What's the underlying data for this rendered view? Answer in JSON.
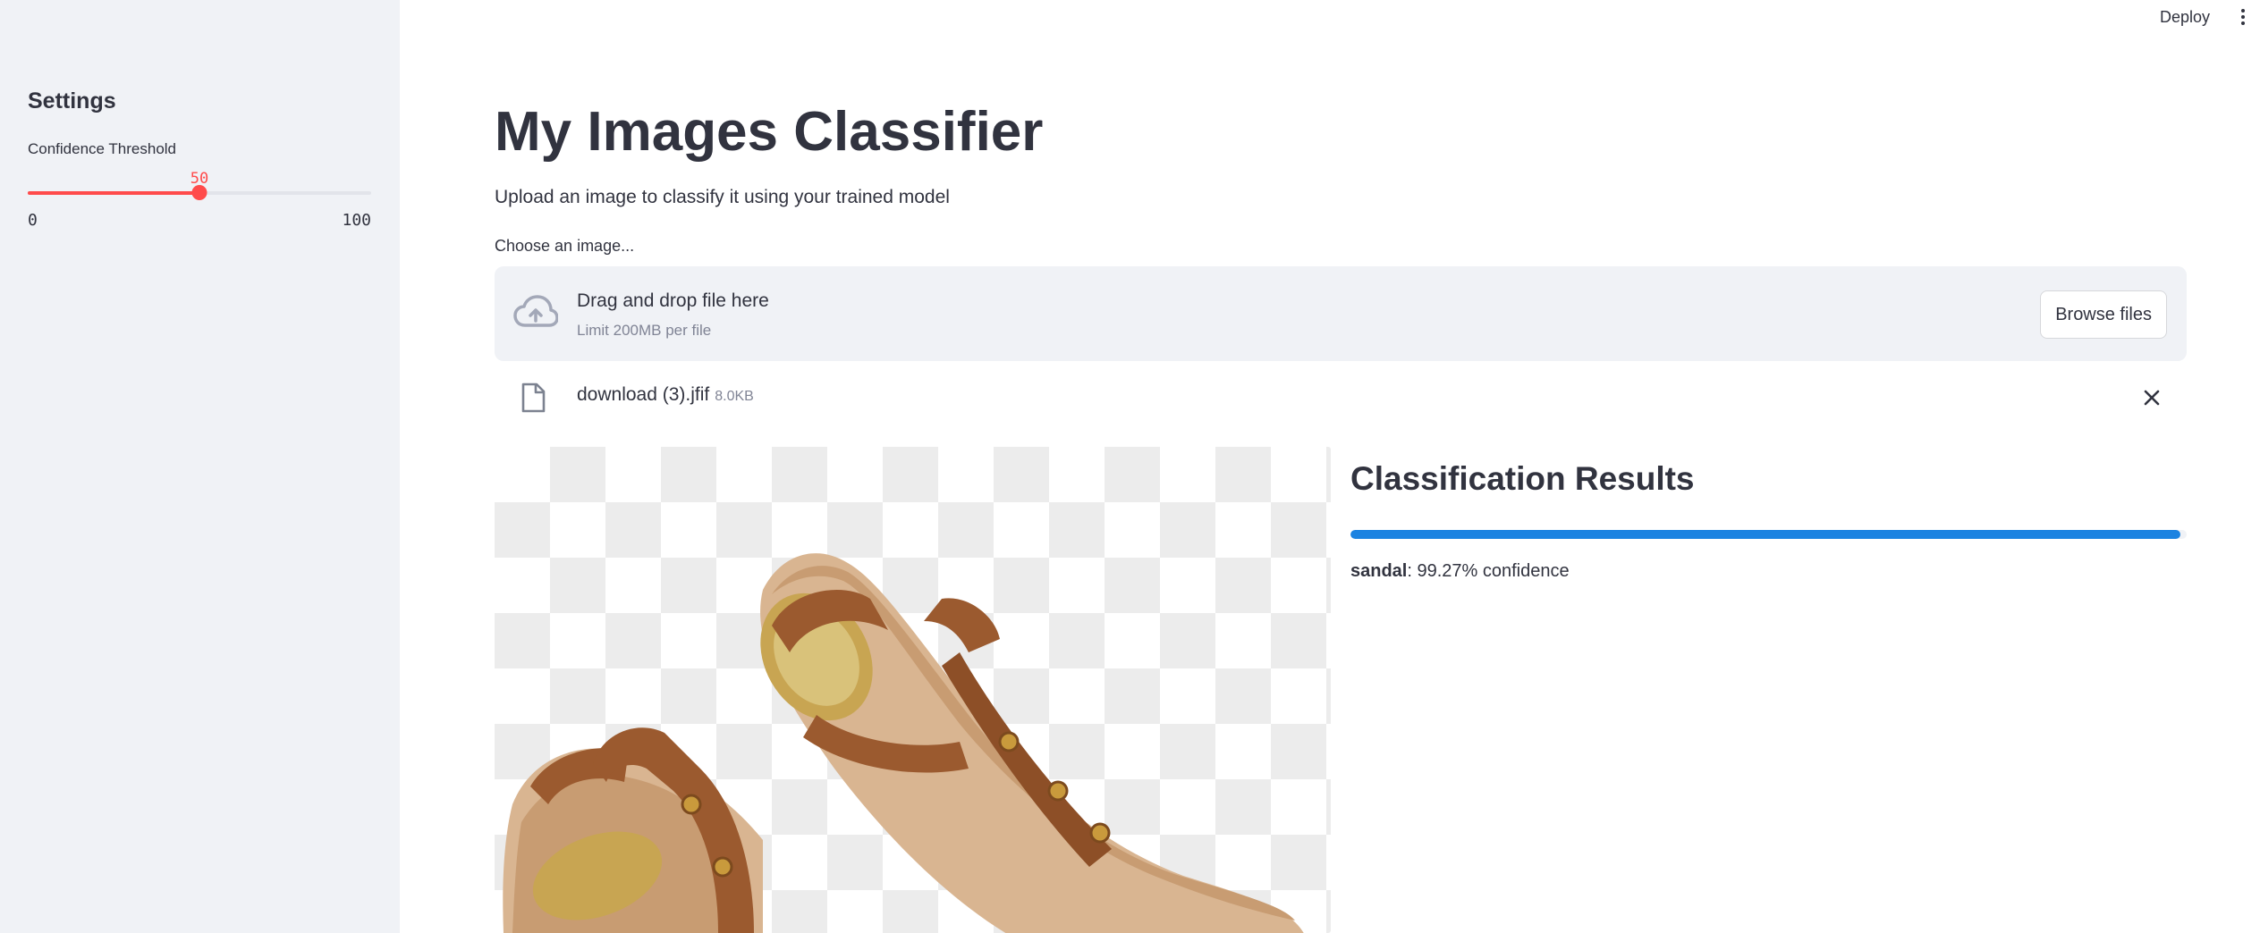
{
  "topbar": {
    "deploy_label": "Deploy",
    "menu_icon": "more-vertical-icon"
  },
  "sidebar": {
    "title": "Settings",
    "slider": {
      "label": "Confidence Threshold",
      "value": "50",
      "min": "0",
      "max": "100",
      "value_num": 50,
      "min_num": 0,
      "max_num": 100,
      "accent": "#ff4b4b"
    }
  },
  "main": {
    "title": "My Images Classifier",
    "subtitle": "Upload an image to classify it using your trained model",
    "uploader": {
      "label": "Choose an image...",
      "drop_text": "Drag and drop file here",
      "limit_text": "Limit 200MB per file",
      "browse_label": "Browse files",
      "icon": "cloud-upload-icon"
    },
    "file": {
      "name": "download (3).jfif",
      "size": "8.0KB",
      "icon": "file-icon",
      "remove_icon": "close-icon"
    },
    "results": {
      "title": "Classification Results",
      "progress": 0.9927,
      "progress_color": "#1c83e1",
      "label": "sandal",
      "confidence_text": ": 99.27% confidence"
    }
  }
}
